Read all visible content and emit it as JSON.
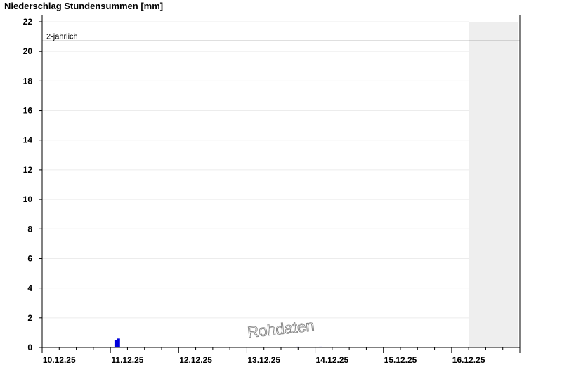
{
  "chart_data": {
    "type": "bar",
    "title": "Niederschlag Stundensummen [mm]",
    "ylim": [
      0,
      22
    ],
    "yticks": [
      0,
      2,
      4,
      6,
      8,
      10,
      12,
      14,
      16,
      18,
      20,
      22
    ],
    "x_range_days": [
      0.0,
      7.0
    ],
    "x_tick_labels": [
      "10.12.25",
      "11.12.25",
      "12.12.25",
      "13.12.25",
      "14.12.25",
      "15.12.25",
      "16.12.25"
    ],
    "forecast_shading_from_day": 6.25,
    "bar_color": "#0000dd",
    "threshold": {
      "label": "2-jährlich",
      "value": 20.7
    },
    "series": [
      {
        "values": [
          {
            "day": 1.08,
            "mm": 0.5
          },
          {
            "day": 1.12,
            "mm": 0.6
          },
          {
            "day": 3.75,
            "mm": 0.05
          },
          {
            "day": 4.08,
            "mm": 0.05
          }
        ]
      }
    ],
    "watermark": "Rohdaten"
  }
}
